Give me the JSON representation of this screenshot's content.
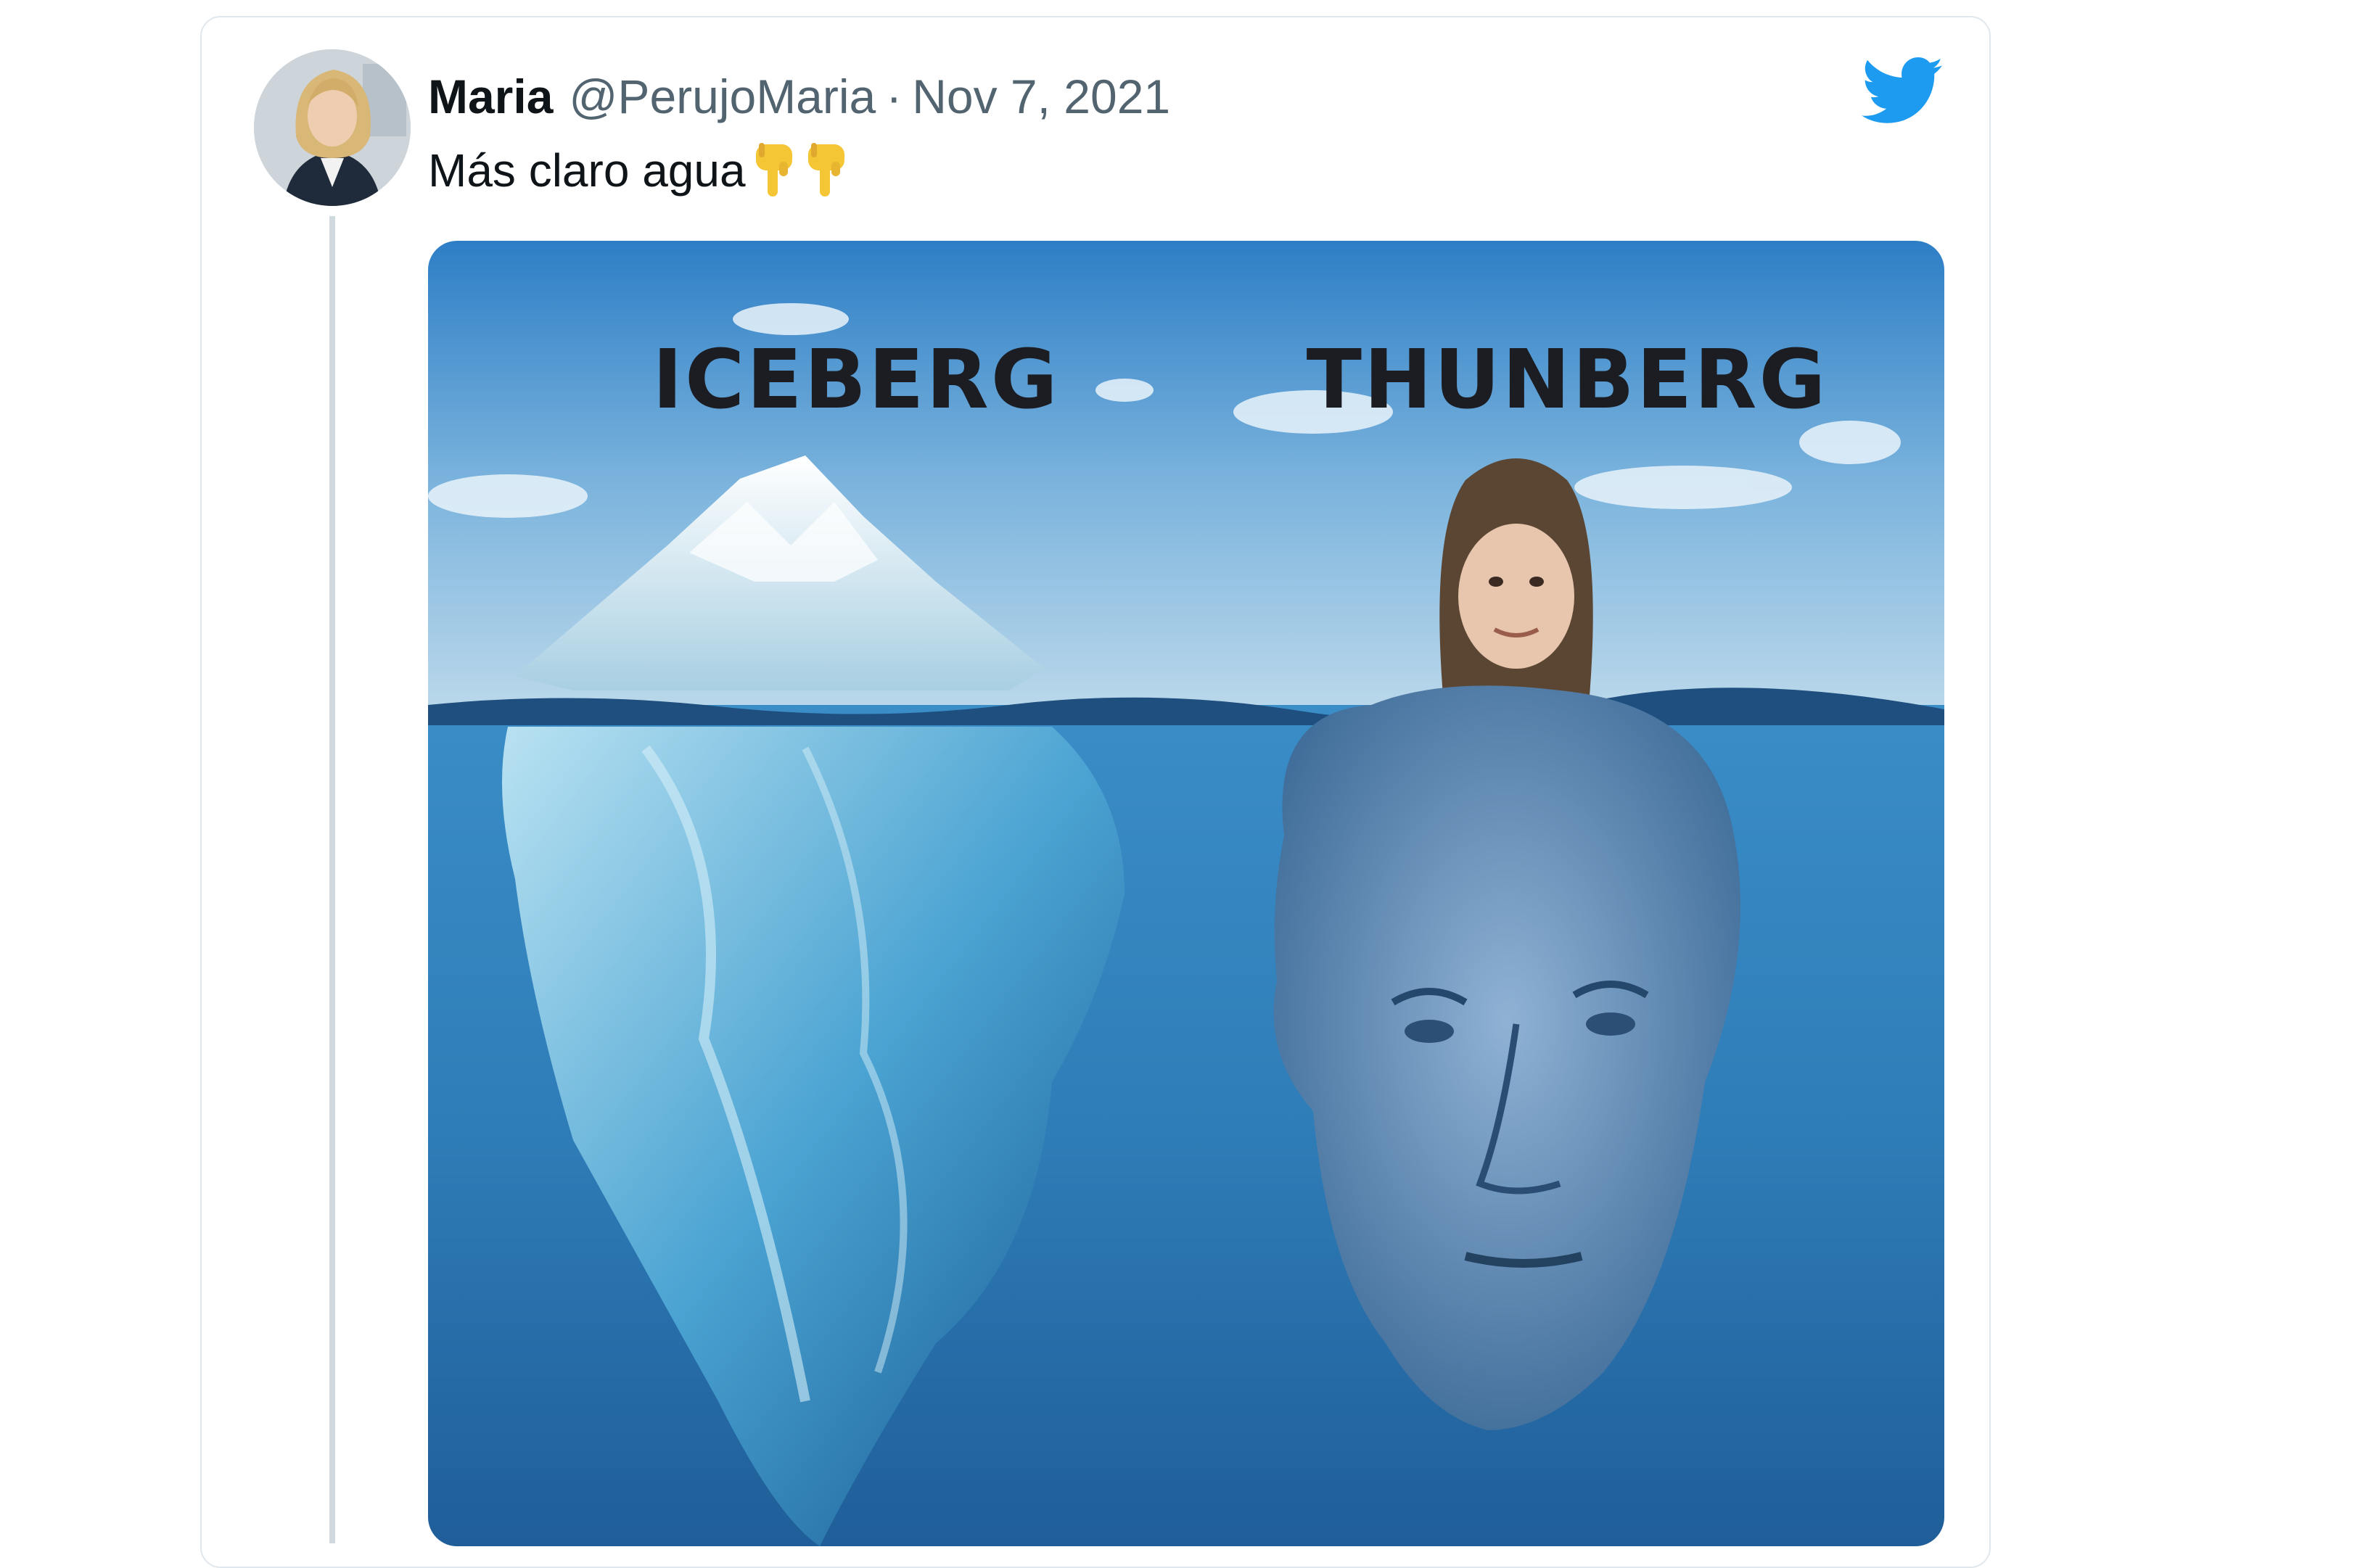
{
  "tweet": {
    "display_name": "Maria",
    "handle": "@PerujoMaria",
    "separator": "·",
    "date": "Nov 7, 2021",
    "text": "Más claro agua",
    "emoji": [
      "backhand-index-pointing-down",
      "backhand-index-pointing-down"
    ]
  },
  "media": {
    "labels": {
      "left": "ICEBERG",
      "right": "THUNBERG"
    }
  },
  "icons": {
    "brand": "twitter-bird-icon"
  },
  "colors": {
    "twitter_blue": "#1d9bf0",
    "secondary_text": "#536471",
    "card_border": "#e1e8ed",
    "thread_line": "#cfd9de"
  }
}
